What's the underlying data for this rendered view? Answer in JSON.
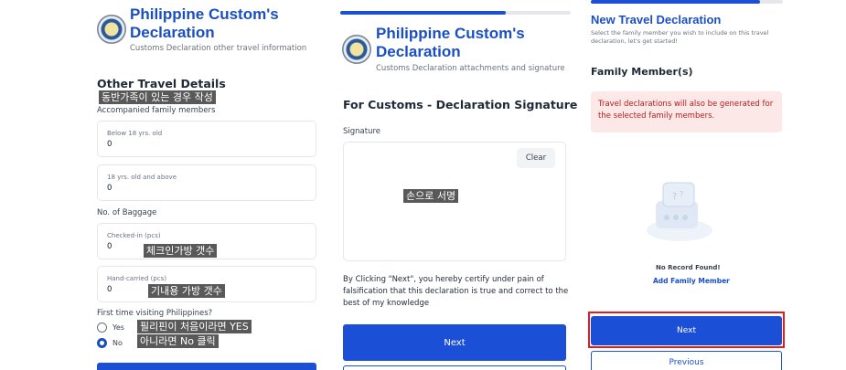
{
  "panel1": {
    "app_title": "Philippine Custom's Declaration",
    "app_subtitle": "Customs Declaration other travel information",
    "section_title": "Other Travel Details",
    "note_family": "동반가족이 있는 경우 작성",
    "accompanied_label": "Accompanied family members",
    "below18_label": "Below 18 yrs. old",
    "below18_value": "0",
    "above18_label": "18 yrs. old and above",
    "above18_value": "0",
    "baggage_label": "No. of Baggage",
    "checked_label": "Checked-in (pcs)",
    "checked_value": "0",
    "note_checked": "체크인가방 갯수",
    "carried_label": "Hand-carried (pcs)",
    "carried_value": "0",
    "note_carried": "기내용 가방 갯수",
    "first_time_label": "First time visiting Philippines?",
    "yes_label": "Yes",
    "no_label": "No",
    "selected_option": "No",
    "note_first_line1": "필리핀이 처음이라면 YES",
    "note_first_line2": "아니라면 No 클릭"
  },
  "panel2": {
    "app_title": "Philippine Custom's Declaration",
    "app_subtitle": "Customs Declaration attachments and signature",
    "progress": 0.72,
    "section_title": "For Customs - Declaration Signature",
    "signature_label": "Signature",
    "clear_label": "Clear",
    "note_sign": "손으로 서명",
    "certify_text": "By Clicking \"Next\", you hereby certify under pain of falsification that this declaration is true and correct to the best of my knowledge",
    "next_label": "Next"
  },
  "panel3": {
    "title": "New Travel Declaration",
    "subtitle": "Select the family member you wish to include on this travel declaration, let's get started!",
    "progress": 0.88,
    "section_title": "Family Member(s)",
    "alert_text": "Travel declarations will also be generated for the selected family members.",
    "no_record": "No Record Found!",
    "add_member": "Add Family Member",
    "next_label": "Next",
    "previous_label": "Previous"
  },
  "colors": {
    "brand_blue": "#1a4fd6",
    "title_blue": "#1a4fc4",
    "alert_bg": "#fde8e8",
    "alert_text": "#b91c1c",
    "highlight_red": "#e11d1d",
    "annotation_bg": "#595959"
  }
}
